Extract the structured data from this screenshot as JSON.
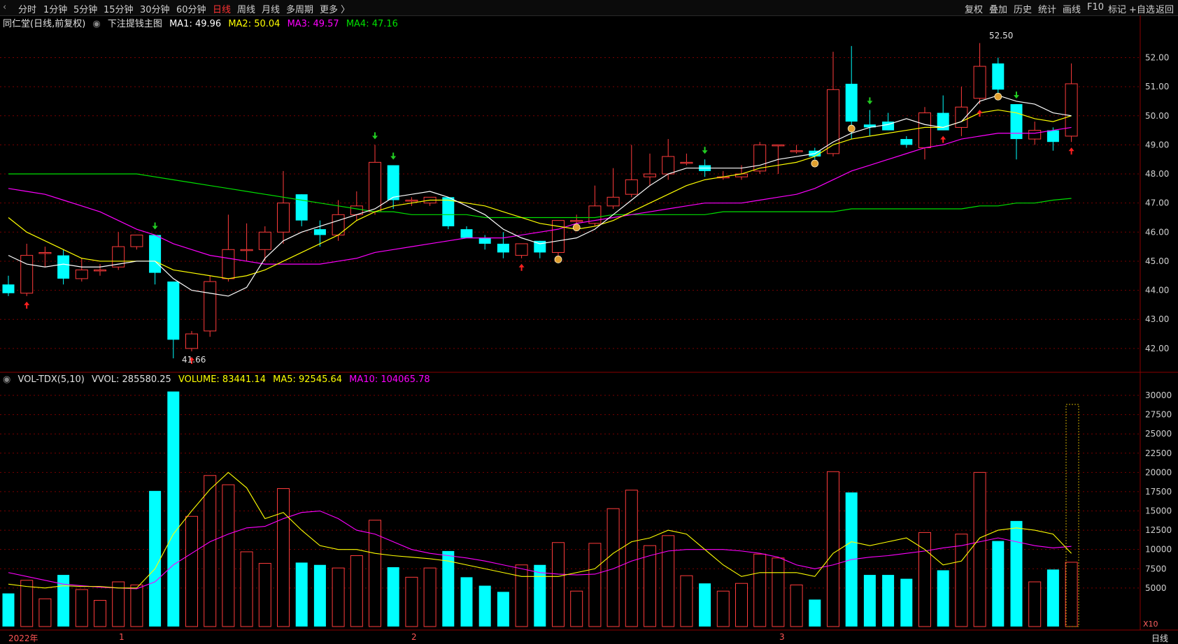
{
  "toolbar": {
    "left_items": [
      "分时",
      "1分钟",
      "5分钟",
      "15分钟",
      "30分钟",
      "60分钟",
      "日线",
      "周线",
      "月线",
      "多周期",
      "更多 〉"
    ],
    "active_item": "日线",
    "right_items": [
      "复权",
      "叠加",
      "历史",
      "统计",
      "画线",
      "F10",
      "标记",
      "+自选",
      "返回"
    ]
  },
  "main_info": {
    "stock": "同仁堂(日线,前复权)",
    "indicator": "下注提钱主图",
    "ma1": "MA1: 49.96",
    "ma2": "MA2: 50.04",
    "ma3": "MA3: 49.57",
    "ma4": "MA4: 47.16"
  },
  "vol_info": {
    "name": "VOL-TDX(5,10)",
    "vvol": "VVOL: 285580.25",
    "volume": "VOLUME: 83441.14",
    "ma5": "MA5: 92545.64",
    "ma10": "MA10: 104065.78"
  },
  "colors": {
    "up": "#ff3b3b",
    "down": "#00ffff",
    "ma1": "#ffffff",
    "ma2": "#ffff00",
    "ma3": "#ff00ff",
    "ma4": "#00e000",
    "grid": "#7a0000",
    "axis_text": "#d0d0d0",
    "background": "#000000"
  },
  "price_axis": {
    "ticks": [
      "52.00",
      "51.00",
      "50.00",
      "49.00",
      "48.00",
      "47.00",
      "46.00",
      "45.00",
      "44.00",
      "43.00",
      "42.00"
    ],
    "range": [
      41.3,
      52.9
    ]
  },
  "volume_axis": {
    "ticks": [
      "30000",
      "27500",
      "25000",
      "22500",
      "20000",
      "17500",
      "15000",
      "12500",
      "10000",
      "7500",
      "5000"
    ],
    "range": [
      0,
      31000
    ],
    "multiplier": "X10"
  },
  "time_axis": {
    "labels": [
      "2022年",
      "1",
      "2",
      "3"
    ],
    "period": "日线"
  },
  "annotations": {
    "high_label": "52.50",
    "low_label": "41.66"
  },
  "chart_data": {
    "type": "candlestick",
    "candles": [
      {
        "o": 44.2,
        "h": 44.5,
        "l": 43.8,
        "c": 43.9,
        "v": 4300
      },
      {
        "o": 43.9,
        "h": 45.6,
        "l": 43.8,
        "c": 45.2,
        "v": 6000
      },
      {
        "o": 45.3,
        "h": 45.5,
        "l": 44.8,
        "c": 45.3,
        "v": 3600
      },
      {
        "o": 45.2,
        "h": 45.4,
        "l": 44.2,
        "c": 44.4,
        "v": 6700
      },
      {
        "o": 44.4,
        "h": 45.1,
        "l": 44.3,
        "c": 44.7,
        "v": 4800
      },
      {
        "o": 44.7,
        "h": 44.9,
        "l": 44.5,
        "c": 44.7,
        "v": 3400
      },
      {
        "o": 44.8,
        "h": 46.0,
        "l": 44.7,
        "c": 45.5,
        "v": 5800
      },
      {
        "o": 45.5,
        "h": 45.9,
        "l": 45.4,
        "c": 45.9,
        "v": 5400
      },
      {
        "o": 45.9,
        "h": 45.9,
        "l": 44.2,
        "c": 44.6,
        "v": 17600
      },
      {
        "o": 44.3,
        "h": 44.3,
        "l": 41.66,
        "c": 42.3,
        "v": 30500
      },
      {
        "o": 42.0,
        "h": 42.6,
        "l": 41.9,
        "c": 42.5,
        "v": 14300
      },
      {
        "o": 42.6,
        "h": 44.5,
        "l": 42.4,
        "c": 44.3,
        "v": 19600
      },
      {
        "o": 44.4,
        "h": 46.6,
        "l": 44.3,
        "c": 45.4,
        "v": 18400
      },
      {
        "o": 45.4,
        "h": 46.3,
        "l": 45.0,
        "c": 45.4,
        "v": 9700
      },
      {
        "o": 45.4,
        "h": 46.2,
        "l": 45.0,
        "c": 46.0,
        "v": 8200
      },
      {
        "o": 46.0,
        "h": 48.1,
        "l": 45.6,
        "c": 47.0,
        "v": 17900
      },
      {
        "o": 47.3,
        "h": 47.3,
        "l": 46.2,
        "c": 46.4,
        "v": 8300
      },
      {
        "o": 46.1,
        "h": 46.4,
        "l": 45.5,
        "c": 45.9,
        "v": 8000
      },
      {
        "o": 45.9,
        "h": 47.1,
        "l": 45.7,
        "c": 46.6,
        "v": 7600
      },
      {
        "o": 46.6,
        "h": 47.4,
        "l": 46.4,
        "c": 46.9,
        "v": 9200
      },
      {
        "o": 46.7,
        "h": 49.0,
        "l": 46.6,
        "c": 48.4,
        "v": 13800
      },
      {
        "o": 48.3,
        "h": 48.3,
        "l": 46.8,
        "c": 47.1,
        "v": 7700
      },
      {
        "o": 47.1,
        "h": 47.2,
        "l": 46.9,
        "c": 47.1,
        "v": 6400
      },
      {
        "o": 47.0,
        "h": 47.2,
        "l": 46.9,
        "c": 47.2,
        "v": 7600
      },
      {
        "o": 47.2,
        "h": 47.2,
        "l": 46.1,
        "c": 46.2,
        "v": 9800
      },
      {
        "o": 46.1,
        "h": 46.2,
        "l": 45.8,
        "c": 45.8,
        "v": 6400
      },
      {
        "o": 45.8,
        "h": 45.9,
        "l": 45.4,
        "c": 45.6,
        "v": 5300
      },
      {
        "o": 45.6,
        "h": 46.0,
        "l": 45.1,
        "c": 45.3,
        "v": 4500
      },
      {
        "o": 45.2,
        "h": 45.6,
        "l": 45.1,
        "c": 45.6,
        "v": 8000
      },
      {
        "o": 45.7,
        "h": 45.7,
        "l": 45.1,
        "c": 45.3,
        "v": 8000
      },
      {
        "o": 45.3,
        "h": 46.4,
        "l": 45.0,
        "c": 46.4,
        "v": 10900
      },
      {
        "o": 46.4,
        "h": 46.6,
        "l": 46.2,
        "c": 46.4,
        "v": 4600
      },
      {
        "o": 46.3,
        "h": 47.6,
        "l": 46.2,
        "c": 46.9,
        "v": 10800
      },
      {
        "o": 46.9,
        "h": 48.2,
        "l": 46.8,
        "c": 47.2,
        "v": 15300
      },
      {
        "o": 47.3,
        "h": 49.0,
        "l": 47.2,
        "c": 47.8,
        "v": 17700
      },
      {
        "o": 47.9,
        "h": 48.7,
        "l": 47.6,
        "c": 48.0,
        "v": 10500
      },
      {
        "o": 48.0,
        "h": 49.2,
        "l": 47.8,
        "c": 48.6,
        "v": 11800
      },
      {
        "o": 48.4,
        "h": 48.7,
        "l": 48.3,
        "c": 48.4,
        "v": 6600
      },
      {
        "o": 48.3,
        "h": 48.5,
        "l": 47.9,
        "c": 48.1,
        "v": 5600
      },
      {
        "o": 47.9,
        "h": 48.1,
        "l": 47.8,
        "c": 47.9,
        "v": 4600
      },
      {
        "o": 47.9,
        "h": 48.3,
        "l": 47.8,
        "c": 48.0,
        "v": 5600
      },
      {
        "o": 48.1,
        "h": 49.1,
        "l": 48.0,
        "c": 49.0,
        "v": 9400
      },
      {
        "o": 49.0,
        "h": 49.0,
        "l": 48.0,
        "c": 49.0,
        "v": 8900
      },
      {
        "o": 48.8,
        "h": 49.0,
        "l": 48.7,
        "c": 48.8,
        "v": 5400
      },
      {
        "o": 48.8,
        "h": 48.9,
        "l": 48.5,
        "c": 48.6,
        "v": 3500
      },
      {
        "o": 48.7,
        "h": 52.2,
        "l": 48.6,
        "c": 50.9,
        "v": 20100
      },
      {
        "o": 51.1,
        "h": 52.4,
        "l": 49.2,
        "c": 49.8,
        "v": 17400
      },
      {
        "o": 49.7,
        "h": 50.2,
        "l": 49.3,
        "c": 49.6,
        "v": 6700
      },
      {
        "o": 49.8,
        "h": 50.1,
        "l": 49.5,
        "c": 49.5,
        "v": 6700
      },
      {
        "o": 49.2,
        "h": 49.3,
        "l": 48.9,
        "c": 49.0,
        "v": 6200
      },
      {
        "o": 48.9,
        "h": 50.3,
        "l": 48.5,
        "c": 50.1,
        "v": 12200
      },
      {
        "o": 50.1,
        "h": 50.7,
        "l": 49.5,
        "c": 49.5,
        "v": 7300
      },
      {
        "o": 49.6,
        "h": 51.0,
        "l": 49.3,
        "c": 50.3,
        "v": 12000
      },
      {
        "o": 50.6,
        "h": 52.5,
        "l": 50.4,
        "c": 51.7,
        "v": 20000
      },
      {
        "o": 51.8,
        "h": 52.0,
        "l": 50.7,
        "c": 50.9,
        "v": 11100
      },
      {
        "o": 50.4,
        "h": 50.4,
        "l": 48.5,
        "c": 49.2,
        "v": 13700
      },
      {
        "o": 49.2,
        "h": 49.8,
        "l": 49.0,
        "c": 49.5,
        "v": 5800
      },
      {
        "o": 49.5,
        "h": 49.6,
        "l": 48.8,
        "c": 49.1,
        "v": 7400
      },
      {
        "o": 49.3,
        "h": 51.8,
        "l": 49.1,
        "c": 51.1,
        "v": 8344
      }
    ],
    "ma1": [
      45.2,
      44.9,
      44.8,
      44.9,
      44.8,
      44.8,
      44.9,
      45.0,
      45.0,
      44.4,
      44.0,
      43.9,
      43.8,
      44.1,
      45.1,
      45.7,
      46.0,
      46.2,
      46.4,
      46.6,
      46.8,
      47.2,
      47.3,
      47.4,
      47.2,
      46.9,
      46.6,
      46.1,
      45.8,
      45.6,
      45.7,
      45.8,
      46.1,
      46.6,
      47.1,
      47.6,
      48.0,
      48.2,
      48.2,
      48.2,
      48.2,
      48.3,
      48.5,
      48.6,
      48.7,
      49.1,
      49.4,
      49.6,
      49.7,
      49.9,
      49.7,
      49.6,
      49.8,
      50.5,
      50.7,
      50.5,
      50.4,
      50.1,
      50.0
    ],
    "ma2": [
      46.5,
      46.0,
      45.7,
      45.4,
      45.1,
      45.0,
      45.0,
      45.0,
      45.0,
      44.7,
      44.6,
      44.5,
      44.4,
      44.5,
      44.7,
      45.0,
      45.3,
      45.6,
      45.9,
      46.4,
      46.7,
      46.9,
      47.0,
      47.1,
      47.1,
      47.0,
      46.9,
      46.7,
      46.5,
      46.3,
      46.2,
      46.1,
      46.2,
      46.4,
      46.7,
      47.0,
      47.3,
      47.6,
      47.8,
      47.9,
      48.0,
      48.2,
      48.3,
      48.4,
      48.6,
      49.0,
      49.2,
      49.3,
      49.4,
      49.5,
      49.6,
      49.6,
      49.8,
      50.1,
      50.2,
      50.1,
      49.9,
      49.8,
      50.0
    ],
    "ma3": [
      47.5,
      47.4,
      47.3,
      47.1,
      46.9,
      46.7,
      46.4,
      46.1,
      45.9,
      45.6,
      45.4,
      45.2,
      45.1,
      45.0,
      44.9,
      44.9,
      44.9,
      44.9,
      45.0,
      45.1,
      45.3,
      45.4,
      45.5,
      45.6,
      45.7,
      45.8,
      45.8,
      45.8,
      45.9,
      46.0,
      46.1,
      46.3,
      46.4,
      46.5,
      46.6,
      46.7,
      46.8,
      46.9,
      47.0,
      47.0,
      47.0,
      47.1,
      47.2,
      47.3,
      47.5,
      47.8,
      48.1,
      48.3,
      48.5,
      48.7,
      48.9,
      49.0,
      49.2,
      49.3,
      49.4,
      49.4,
      49.4,
      49.5,
      49.6
    ],
    "ma4": [
      48.0,
      48.0,
      48.0,
      48.0,
      48.0,
      48.0,
      48.0,
      48.0,
      47.9,
      47.8,
      47.7,
      47.6,
      47.5,
      47.4,
      47.3,
      47.2,
      47.1,
      47.0,
      46.9,
      46.8,
      46.7,
      46.7,
      46.6,
      46.6,
      46.6,
      46.6,
      46.5,
      46.5,
      46.5,
      46.5,
      46.5,
      46.5,
      46.5,
      46.6,
      46.6,
      46.6,
      46.6,
      46.6,
      46.6,
      46.7,
      46.7,
      46.7,
      46.7,
      46.7,
      46.7,
      46.7,
      46.8,
      46.8,
      46.8,
      46.8,
      46.8,
      46.8,
      46.8,
      46.9,
      46.9,
      47.0,
      47.0,
      47.1,
      47.16
    ],
    "vol_ma5": [
      5500,
      5200,
      5000,
      5300,
      5200,
      5200,
      5000,
      5000,
      7500,
      12000,
      15000,
      17800,
      20000,
      18000,
      14000,
      14800,
      12500,
      10500,
      10000,
      10000,
      9500,
      9200,
      9000,
      8800,
      8500,
      8000,
      7500,
      7000,
      6500,
      6500,
      6500,
      7000,
      7500,
      9500,
      11000,
      11500,
      12500,
      12000,
      10000,
      8000,
      6500,
      7000,
      7000,
      7000,
      6500,
      9500,
      11000,
      10500,
      11000,
      11500,
      10000,
      8000,
      8500,
      11500,
      12500,
      12800,
      12500,
      12000,
      9500
    ],
    "vol_ma10": [
      7000,
      6500,
      6000,
      5500,
      5300,
      5100,
      5000,
      4900,
      5800,
      8000,
      9500,
      11000,
      12000,
      12800,
      13000,
      14000,
      14800,
      15000,
      14000,
      12500,
      12000,
      11000,
      10000,
      9500,
      9200,
      8900,
      8500,
      8000,
      7500,
      7000,
      6800,
      6700,
      6800,
      7500,
      8500,
      9200,
      9800,
      10000,
      10000,
      10000,
      9800,
      9500,
      9000,
      8000,
      7500,
      8000,
      8700,
      9000,
      9200,
      9500,
      9800,
      10200,
      10500,
      11000,
      11500,
      11000,
      10500,
      10200,
      10406
    ]
  }
}
